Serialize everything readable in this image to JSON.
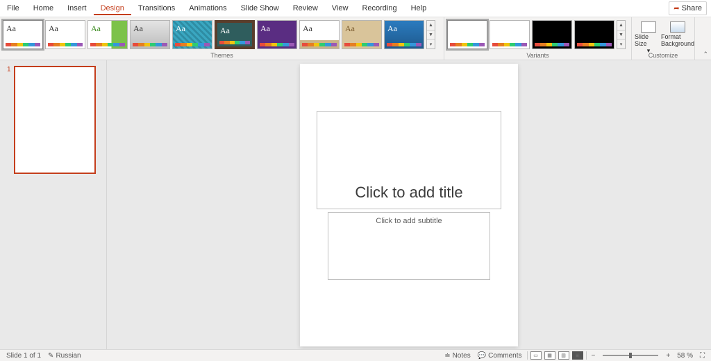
{
  "menubar": {
    "items": [
      "File",
      "Home",
      "Insert",
      "Design",
      "Transitions",
      "Animations",
      "Slide Show",
      "Review",
      "View",
      "Recording",
      "Help"
    ],
    "active_index": 3,
    "share_label": "Share"
  },
  "ribbon": {
    "themes_label": "Themes",
    "variants_label": "Variants",
    "customize_label": "Customize",
    "slide_size_label": "Slide Size",
    "format_bg_label": "Format Background",
    "aa": "Aa"
  },
  "slide_panel": {
    "slides": [
      {
        "number": "1"
      }
    ]
  },
  "slide": {
    "title_placeholder": "Click to add title",
    "subtitle_placeholder": "Click to add subtitle"
  },
  "statusbar": {
    "slide_info": "Slide 1 of 1",
    "language": "Russian",
    "notes_label": "Notes",
    "comments_label": "Comments",
    "zoom_text": "58 %",
    "minus": "−",
    "plus": "+"
  }
}
